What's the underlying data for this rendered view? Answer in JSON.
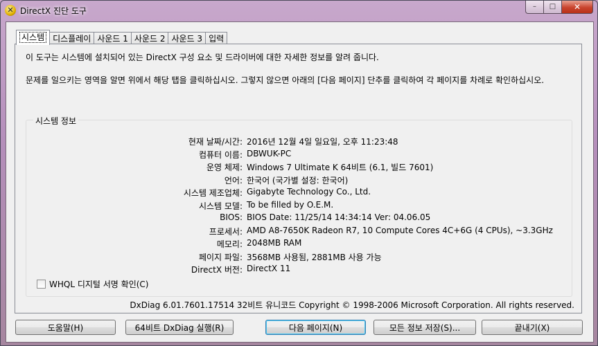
{
  "window": {
    "title": "DirectX 진단 도구"
  },
  "caption": {
    "min": "–",
    "max": "□",
    "close": "✕"
  },
  "tabs": [
    {
      "label": "시스템"
    },
    {
      "label": "디스플레이"
    },
    {
      "label": "사운드 1"
    },
    {
      "label": "사운드 2"
    },
    {
      "label": "사운드 3"
    },
    {
      "label": "입력"
    }
  ],
  "intro": {
    "line1": "이 도구는 시스템에 설치되어 있는 DirectX 구성 요소 및 드라이버에 대한 자세한 정보를 알려 줍니다.",
    "line2": "문제를 일으키는 영역을 알면 위에서 해당 탭을 클릭하십시오. 그렇지 않으면 아래의 [다음 페이지] 단추를 클릭하여 각 페이지를 차례로 확인하십시오."
  },
  "system_info": {
    "title": "시스템 정보",
    "rows": [
      {
        "k": "현재 날짜/시간:",
        "v": "2016년 12월 4일 일요일, 오후 11:23:48"
      },
      {
        "k": "컴퓨터 이름:",
        "v": "DBWUK-PC"
      },
      {
        "k": "운영 체제:",
        "v": "Windows 7 Ultimate K 64비트 (6.1, 빌드 7601)"
      },
      {
        "k": "언어:",
        "v": "한국어 (국가별 설정: 한국어)"
      },
      {
        "k": "시스템 제조업체:",
        "v": "Gigabyte Technology Co., Ltd."
      },
      {
        "k": "시스템 모델:",
        "v": "To be filled by O.E.M."
      },
      {
        "k": "BIOS:",
        "v": "BIOS Date: 11/25/14 14:34:14 Ver: 04.06.05"
      },
      {
        "k": "프로세서:",
        "v": "AMD A8-7650K Radeon R7, 10 Compute Cores 4C+6G  (4 CPUs), ~3.3GHz"
      },
      {
        "k": "메모리:",
        "v": "2048MB RAM"
      },
      {
        "k": "페이지 파일:",
        "v": "3568MB 사용됨, 2881MB 사용 가능"
      },
      {
        "k": "DirectX 버전:",
        "v": "DirectX 11"
      }
    ]
  },
  "whql": {
    "label": "WHQL 디지털 서명 확인(C)",
    "checked": false
  },
  "footer": "DxDiag 6.01.7601.17514 32비트 유니코드  Copyright © 1998-2006 Microsoft Corporation.  All rights reserved.",
  "buttons": {
    "help": "도움말(H)",
    "run64": "64비트 DxDiag 실행(R)",
    "next": "다음 페이지(N)",
    "save": "모든 정보 저장(S)...",
    "exit": "끝내기(X)"
  }
}
